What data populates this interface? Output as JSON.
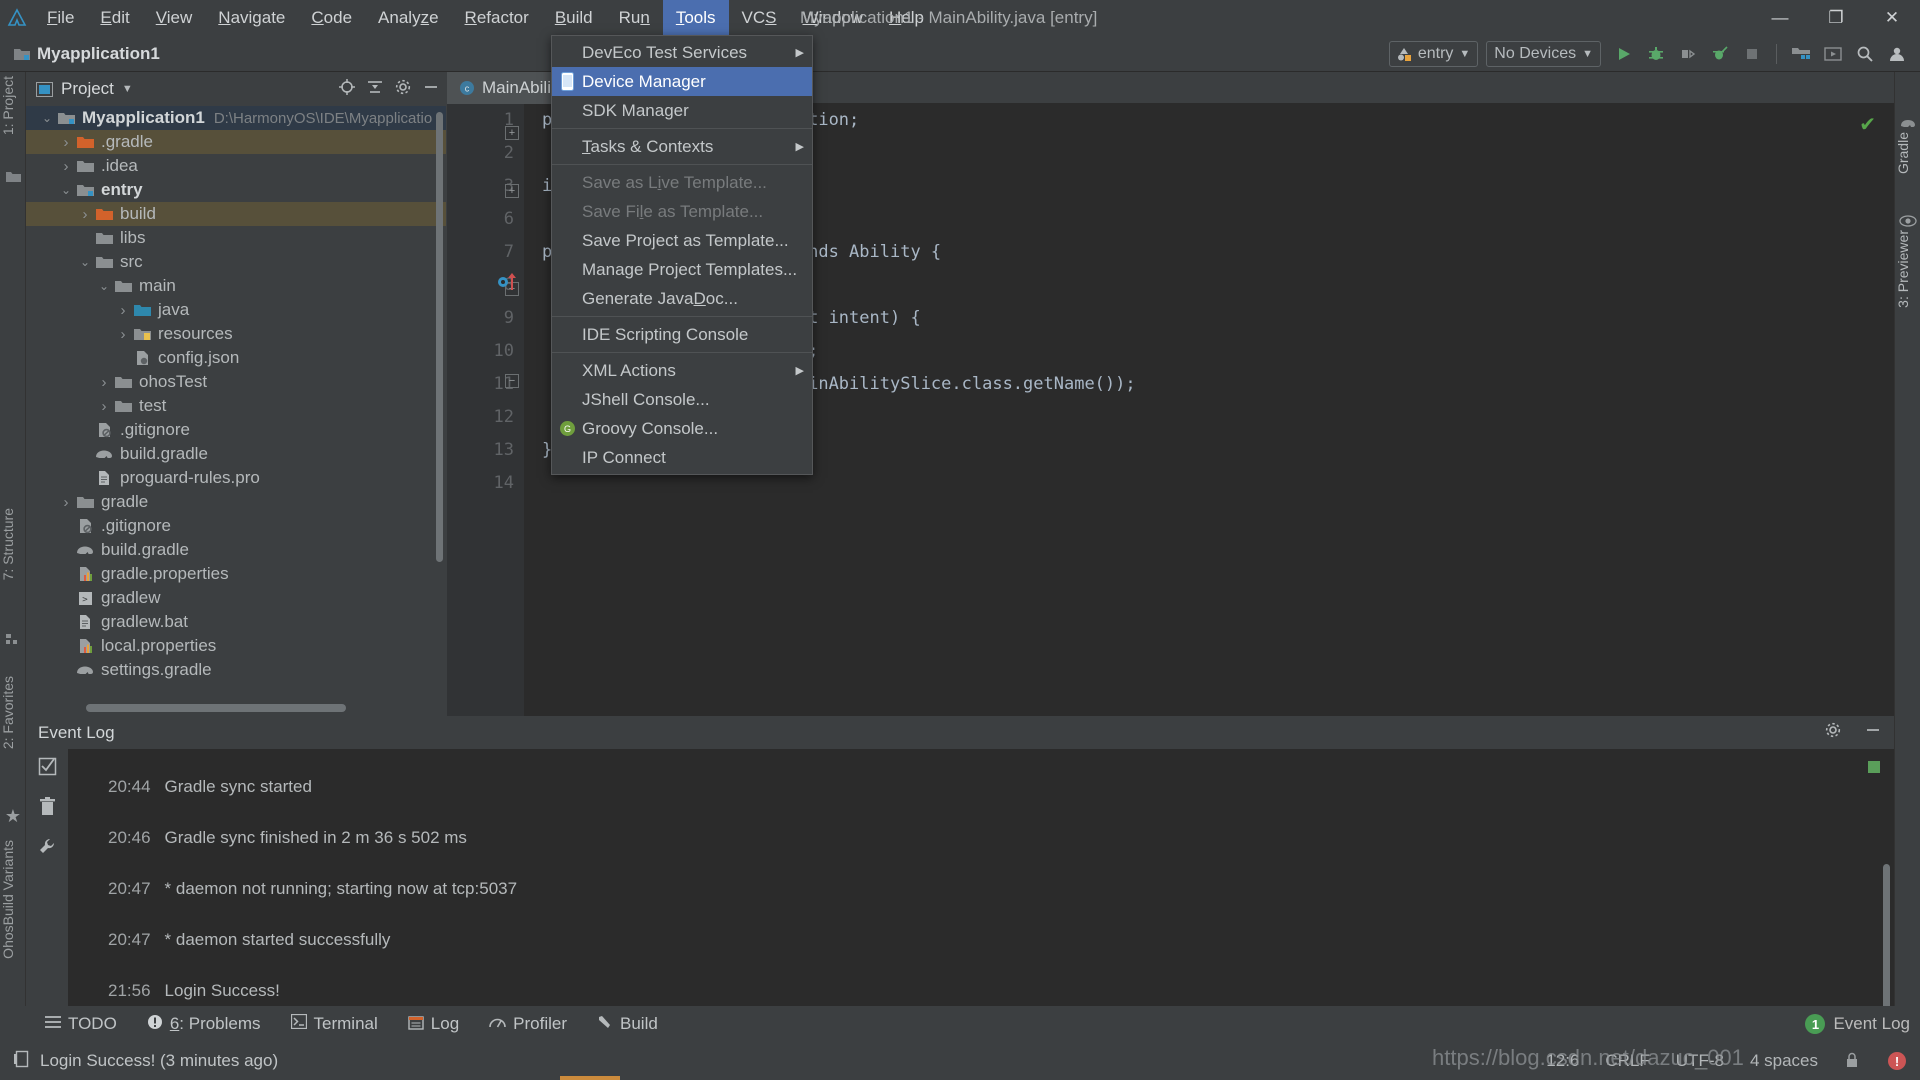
{
  "window": {
    "title": "Myapplication1 - MainAbility.java [entry]",
    "minimize_label": "—",
    "maximize_label": "❐",
    "close_label": "✕"
  },
  "menubar": {
    "items": [
      {
        "label": "File",
        "mnemonic": "F"
      },
      {
        "label": "Edit",
        "mnemonic": "E"
      },
      {
        "label": "View",
        "mnemonic": "V"
      },
      {
        "label": "Navigate",
        "mnemonic": "N"
      },
      {
        "label": "Code",
        "mnemonic": "C"
      },
      {
        "label": "Analyze",
        "mnemonic": "z"
      },
      {
        "label": "Refactor",
        "mnemonic": "R"
      },
      {
        "label": "Build",
        "mnemonic": "B"
      },
      {
        "label": "Run",
        "mnemonic": "n"
      },
      {
        "label": "Tools",
        "mnemonic": "T",
        "active": true
      },
      {
        "label": "VCS",
        "mnemonic": "S"
      },
      {
        "label": "Window",
        "mnemonic": "W"
      },
      {
        "label": "Help",
        "mnemonic": "H"
      }
    ]
  },
  "toolbar": {
    "project_chip": "Myapplication1",
    "run_config": "entry",
    "device_selector": "No Devices",
    "icons": [
      "run-icon",
      "debug-icon",
      "attach-debugger-icon",
      "profile-icon",
      "stop-icon",
      "project-structure-icon",
      "previewer-icon",
      "search-everywhere-icon",
      "account-icon"
    ]
  },
  "tools_menu": {
    "items": [
      {
        "label": "DevEco Test Services",
        "submenu": true,
        "disabled": false,
        "icon": "",
        "selected": false
      },
      {
        "label": "Device Manager",
        "submenu": false,
        "disabled": false,
        "icon": "device-manager-icon",
        "selected": true
      },
      {
        "label": "SDK Manager",
        "submenu": false,
        "disabled": false,
        "icon": "",
        "selected": false
      },
      {
        "separator": true
      },
      {
        "label": "Tasks & Contexts",
        "submenu": true,
        "disabled": false,
        "icon": "",
        "selected": false,
        "mnemonic": "T"
      },
      {
        "separator": true
      },
      {
        "label": "Save as Live Template...",
        "submenu": false,
        "disabled": true,
        "icon": "",
        "selected": false,
        "mnemonic": "i"
      },
      {
        "label": "Save File as Template...",
        "submenu": false,
        "disabled": true,
        "icon": "",
        "selected": false,
        "mnemonic": "l"
      },
      {
        "label": "Save Project as Template...",
        "submenu": false,
        "disabled": false,
        "icon": "",
        "selected": false
      },
      {
        "label": "Manage Project Templates...",
        "submenu": false,
        "disabled": false,
        "icon": "",
        "selected": false
      },
      {
        "label": "Generate JavaDoc...",
        "submenu": false,
        "disabled": false,
        "icon": "",
        "selected": false,
        "mnemonic": "D"
      },
      {
        "separator": true
      },
      {
        "label": "IDE Scripting Console",
        "submenu": false,
        "disabled": false,
        "icon": "",
        "selected": false
      },
      {
        "separator": true
      },
      {
        "label": "XML Actions",
        "submenu": true,
        "disabled": false,
        "icon": "",
        "selected": false
      },
      {
        "label": "JShell Console...",
        "submenu": false,
        "disabled": false,
        "icon": "",
        "selected": false
      },
      {
        "label": "Groovy Console...",
        "submenu": false,
        "disabled": false,
        "icon": "groovy-icon",
        "selected": false
      },
      {
        "label": "IP Connect",
        "submenu": false,
        "disabled": false,
        "icon": "",
        "selected": false
      }
    ]
  },
  "project_panel": {
    "title": "Project",
    "tree": [
      {
        "indent": 0,
        "arrow": "down",
        "icon": "module-folder-icon",
        "name": "Myapplication1",
        "sub": "D:\\HarmonyOS\\IDE\\Myapplicatio",
        "bold": true,
        "state": "selected"
      },
      {
        "indent": 1,
        "arrow": "right",
        "icon": "excluded-folder-icon",
        "name": ".gradle",
        "sub": "",
        "bold": false,
        "state": "highlight"
      },
      {
        "indent": 1,
        "arrow": "right",
        "icon": "folder-icon",
        "name": ".idea",
        "sub": "",
        "bold": false,
        "state": ""
      },
      {
        "indent": 1,
        "arrow": "down",
        "icon": "module-folder-icon",
        "name": "entry",
        "sub": "",
        "bold": true,
        "state": ""
      },
      {
        "indent": 2,
        "arrow": "right",
        "icon": "excluded-folder-icon",
        "name": "build",
        "sub": "",
        "bold": false,
        "state": "highlight"
      },
      {
        "indent": 2,
        "arrow": "none",
        "icon": "folder-icon",
        "name": "libs",
        "sub": "",
        "bold": false,
        "state": ""
      },
      {
        "indent": 2,
        "arrow": "down",
        "icon": "folder-icon",
        "name": "src",
        "sub": "",
        "bold": false,
        "state": ""
      },
      {
        "indent": 3,
        "arrow": "down",
        "icon": "folder-icon",
        "name": "main",
        "sub": "",
        "bold": false,
        "state": ""
      },
      {
        "indent": 4,
        "arrow": "right",
        "icon": "source-folder-icon",
        "name": "java",
        "sub": "",
        "bold": false,
        "state": ""
      },
      {
        "indent": 4,
        "arrow": "right",
        "icon": "resource-folder-icon",
        "name": "resources",
        "sub": "",
        "bold": false,
        "state": ""
      },
      {
        "indent": 4,
        "arrow": "none",
        "icon": "json-file-icon",
        "name": "config.json",
        "sub": "",
        "bold": false,
        "state": ""
      },
      {
        "indent": 3,
        "arrow": "right",
        "icon": "folder-icon",
        "name": "ohosTest",
        "sub": "",
        "bold": false,
        "state": ""
      },
      {
        "indent": 3,
        "arrow": "right",
        "icon": "folder-icon",
        "name": "test",
        "sub": "",
        "bold": false,
        "state": ""
      },
      {
        "indent": 2,
        "arrow": "none",
        "icon": "gitignore-file-icon",
        "name": ".gitignore",
        "sub": "",
        "bold": false,
        "state": ""
      },
      {
        "indent": 2,
        "arrow": "none",
        "icon": "gradle-file-icon",
        "name": "build.gradle",
        "sub": "",
        "bold": false,
        "state": ""
      },
      {
        "indent": 2,
        "arrow": "none",
        "icon": "text-file-icon",
        "name": "proguard-rules.pro",
        "sub": "",
        "bold": false,
        "state": ""
      },
      {
        "indent": 1,
        "arrow": "right",
        "icon": "folder-icon",
        "name": "gradle",
        "sub": "",
        "bold": false,
        "state": ""
      },
      {
        "indent": 1,
        "arrow": "none",
        "icon": "gitignore-file-icon",
        "name": ".gitignore",
        "sub": "",
        "bold": false,
        "state": ""
      },
      {
        "indent": 1,
        "arrow": "none",
        "icon": "gradle-file-icon",
        "name": "build.gradle",
        "sub": "",
        "bold": false,
        "state": ""
      },
      {
        "indent": 1,
        "arrow": "none",
        "icon": "properties-file-icon",
        "name": "gradle.properties",
        "sub": "",
        "bold": false,
        "state": ""
      },
      {
        "indent": 1,
        "arrow": "none",
        "icon": "script-file-icon",
        "name": "gradlew",
        "sub": "",
        "bold": false,
        "state": ""
      },
      {
        "indent": 1,
        "arrow": "none",
        "icon": "text-file-icon",
        "name": "gradlew.bat",
        "sub": "",
        "bold": false,
        "state": ""
      },
      {
        "indent": 1,
        "arrow": "none",
        "icon": "properties-file-icon",
        "name": "local.properties",
        "sub": "",
        "bold": false,
        "state": ""
      },
      {
        "indent": 1,
        "arrow": "none",
        "icon": "gradle-file-icon",
        "name": "settings.gradle",
        "sub": "",
        "bold": false,
        "state": ""
      }
    ]
  },
  "editor": {
    "tab_label": "MainAbili",
    "line_numbers": [
      "1",
      "2",
      "3",
      "6",
      "7",
      "8",
      "9",
      "10",
      "11",
      "12",
      "13",
      "14"
    ],
    "code_lines": [
      "p                   pplication;",
      "",
      "i",
      "",
      "p                   y extends Ability {",
      "",
      "                    (Intent intent) {",
      "                    ntent);",
      "                    ute(MainAbilitySlice.class.getName());",
      "        }",
      "}",
      ""
    ]
  },
  "left_stripe": {
    "top_tabs": [
      "1: Project"
    ],
    "bottom_tabs": [
      "7: Structure",
      "2: Favorites",
      "OhosBuild Variants"
    ]
  },
  "right_stripe": {
    "tabs": [
      "Gradle",
      "3: Previewer"
    ]
  },
  "event_log": {
    "title": "Event Log",
    "entries": [
      {
        "time": "20:44",
        "text": "Gradle sync started"
      },
      {
        "time": "20:46",
        "text": "Gradle sync finished in 2 m 36 s 502 ms"
      },
      {
        "time": "20:47",
        "text": "* daemon not running; starting now at tcp:5037"
      },
      {
        "time": "20:47",
        "text": "* daemon started successfully"
      },
      {
        "time": "21:56",
        "text": "Login Success!"
      }
    ],
    "tool_icons": [
      "mark-read-icon",
      "delete-icon",
      "settings-icon"
    ],
    "head_icons": [
      "settings-gear-icon",
      "hide-icon"
    ]
  },
  "bottom_stripe": {
    "items": [
      {
        "label": "TODO",
        "icon": "todo-icon",
        "mnemonic": ""
      },
      {
        "label": "6: Problems",
        "icon": "problems-icon",
        "mnemonic": "6"
      },
      {
        "label": "Terminal",
        "icon": "terminal-icon",
        "mnemonic": ""
      },
      {
        "label": "Log",
        "icon": "log-icon",
        "mnemonic": ""
      },
      {
        "label": "Profiler",
        "icon": "profiler-icon",
        "mnemonic": ""
      },
      {
        "label": "Build",
        "icon": "build-icon",
        "mnemonic": ""
      }
    ],
    "event_log_button": "Event Log",
    "event_log_badge": "1"
  },
  "status_bar": {
    "message": "Login Success! (3 minutes ago)",
    "caret_position": "12:6",
    "line_separator": "CRLF",
    "encoding": "UTF-8",
    "indent": "4 spaces"
  },
  "watermark": "https://blog.csdn.net/dazuo_001",
  "colors": {
    "accent_blue": "#4b6eaf",
    "panel_bg": "#3c3f41",
    "editor_bg": "#2b2b2b",
    "gutter_bg": "#313335",
    "keyword_orange": "#cc7832",
    "text_grey": "#a9b7c6",
    "green": "#499c54",
    "highlight_row": "#57503a"
  }
}
